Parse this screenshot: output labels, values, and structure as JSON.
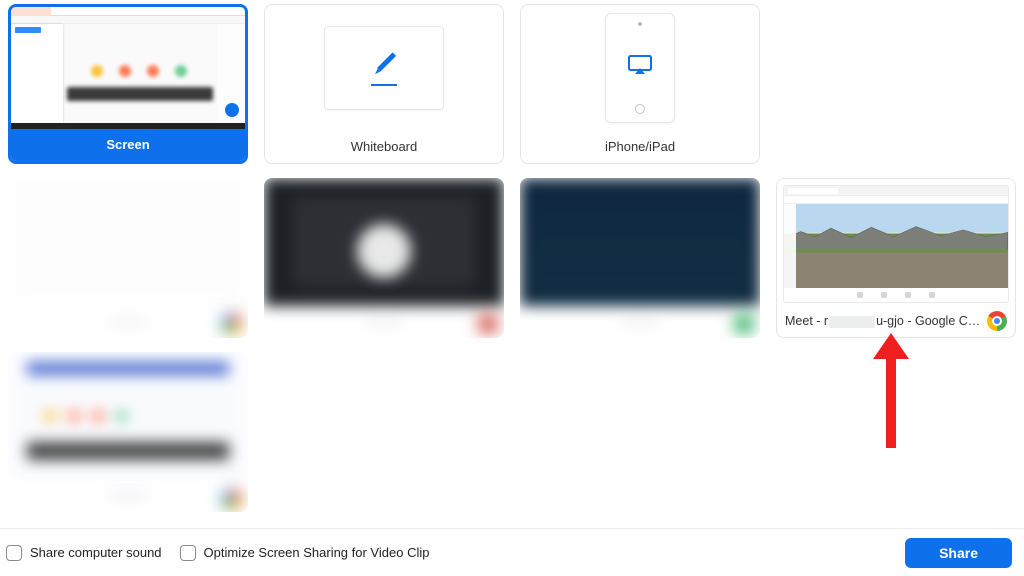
{
  "tiles": {
    "screen": {
      "label": "Screen"
    },
    "whiteboard": {
      "label": "Whiteboard"
    },
    "iphone": {
      "label": "iPhone/iPad"
    },
    "meet": {
      "label_prefix": "Meet - r",
      "label_suffix": "u-gjo - Google C…",
      "app_icon": "chrome-icon"
    }
  },
  "footer": {
    "sound_label": "Share computer sound",
    "optimize_label": "Optimize Screen Sharing for Video Clip",
    "share_label": "Share"
  },
  "colors": {
    "accent": "#0e71eb",
    "annotation": "#ef1f1f"
  }
}
